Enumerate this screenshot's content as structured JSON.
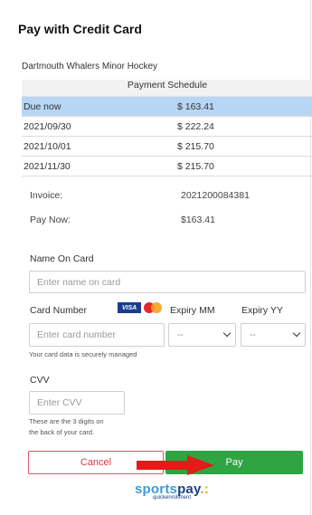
{
  "title": "Pay with Credit Card",
  "organization": "Dartmouth Whalers Minor Hockey",
  "schedule": {
    "header": "Payment Schedule",
    "rows": [
      {
        "date": "Due now",
        "amount": "$ 163.41",
        "selected": true
      },
      {
        "date": "2021/09/30",
        "amount": "$ 222.24"
      },
      {
        "date": "2021/10/01",
        "amount": "$ 215.70"
      },
      {
        "date": "2021/11/30",
        "amount": "$ 215.70"
      }
    ]
  },
  "invoice": {
    "label": "Invoice:",
    "value": "2021200084381"
  },
  "pay_now": {
    "label": "Pay Now:",
    "value": "$163.41"
  },
  "form": {
    "name_label": "Name On Card",
    "name_placeholder": "Enter name on card",
    "card_label": "Card Number",
    "card_placeholder": "Enter card number",
    "card_note": "Your card data is securely managed",
    "expiry_mm_label": "Expiry MM",
    "expiry_mm_value": "--",
    "expiry_yy_label": "Expiry YY",
    "expiry_yy_value": "--",
    "cvv_label": "CVV",
    "cvv_placeholder": "Enter CVV",
    "cvv_note_1": "These are the 3 digits on",
    "cvv_note_2": "the back of your card."
  },
  "card_logos": {
    "visa": "VISA"
  },
  "buttons": {
    "cancel": "Cancel",
    "pay": "Pay"
  },
  "logo": {
    "part1": "sports",
    "part2": "pay",
    "sub": "quickenrollment"
  },
  "colors": {
    "pay_button": "#2ea443",
    "cancel_border": "#e05561",
    "selected_row": "#b7d6f5",
    "arrow": "#e41b17"
  }
}
